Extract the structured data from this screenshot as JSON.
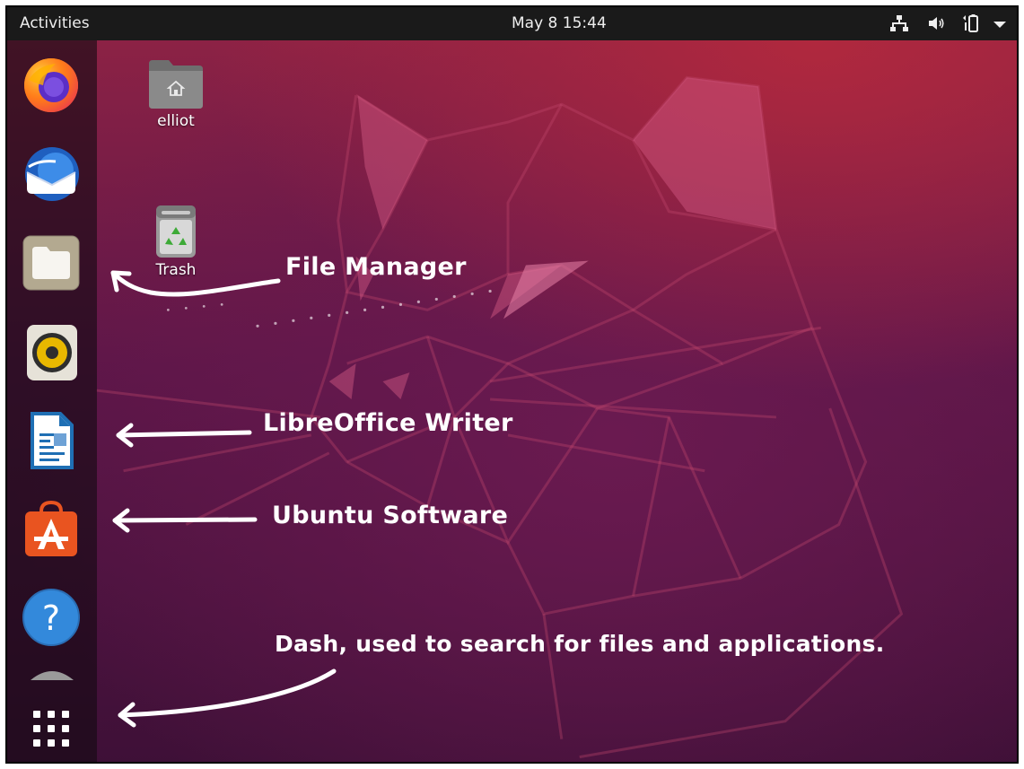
{
  "topbar": {
    "activities_label": "Activities",
    "clock": "May 8  15:44",
    "tray_icons": [
      "network-icon",
      "volume-icon",
      "battery-icon",
      "system-menu-chevron-icon"
    ]
  },
  "dock": {
    "items": [
      {
        "name": "Firefox",
        "icon": "firefox-icon"
      },
      {
        "name": "Thunderbird",
        "icon": "thunderbird-icon"
      },
      {
        "name": "Files",
        "icon": "files-icon"
      },
      {
        "name": "Rhythmbox",
        "icon": "rhythmbox-icon"
      },
      {
        "name": "LibreOffice Writer",
        "icon": "libreoffice-writer-icon"
      },
      {
        "name": "Ubuntu Software",
        "icon": "ubuntu-software-icon"
      },
      {
        "name": "Help",
        "icon": "help-icon"
      },
      {
        "name": "Show Applications",
        "icon": "app-grid-icon"
      }
    ]
  },
  "desktop": {
    "icons": [
      {
        "label": "elliot",
        "icon": "home-folder-icon"
      },
      {
        "label": "Trash",
        "icon": "trash-icon"
      }
    ]
  },
  "annotations": {
    "file_manager": "File Manager",
    "libreoffice_writer": "LibreOffice Writer",
    "ubuntu_software": "Ubuntu Software",
    "dash": "Dash, used to search for files and applications."
  },
  "colors": {
    "topbar": "#1a1a1a",
    "wallpaper_top": "#8c2245",
    "wallpaper_bottom": "#3e1037",
    "annotation_text": "#ffffff"
  }
}
